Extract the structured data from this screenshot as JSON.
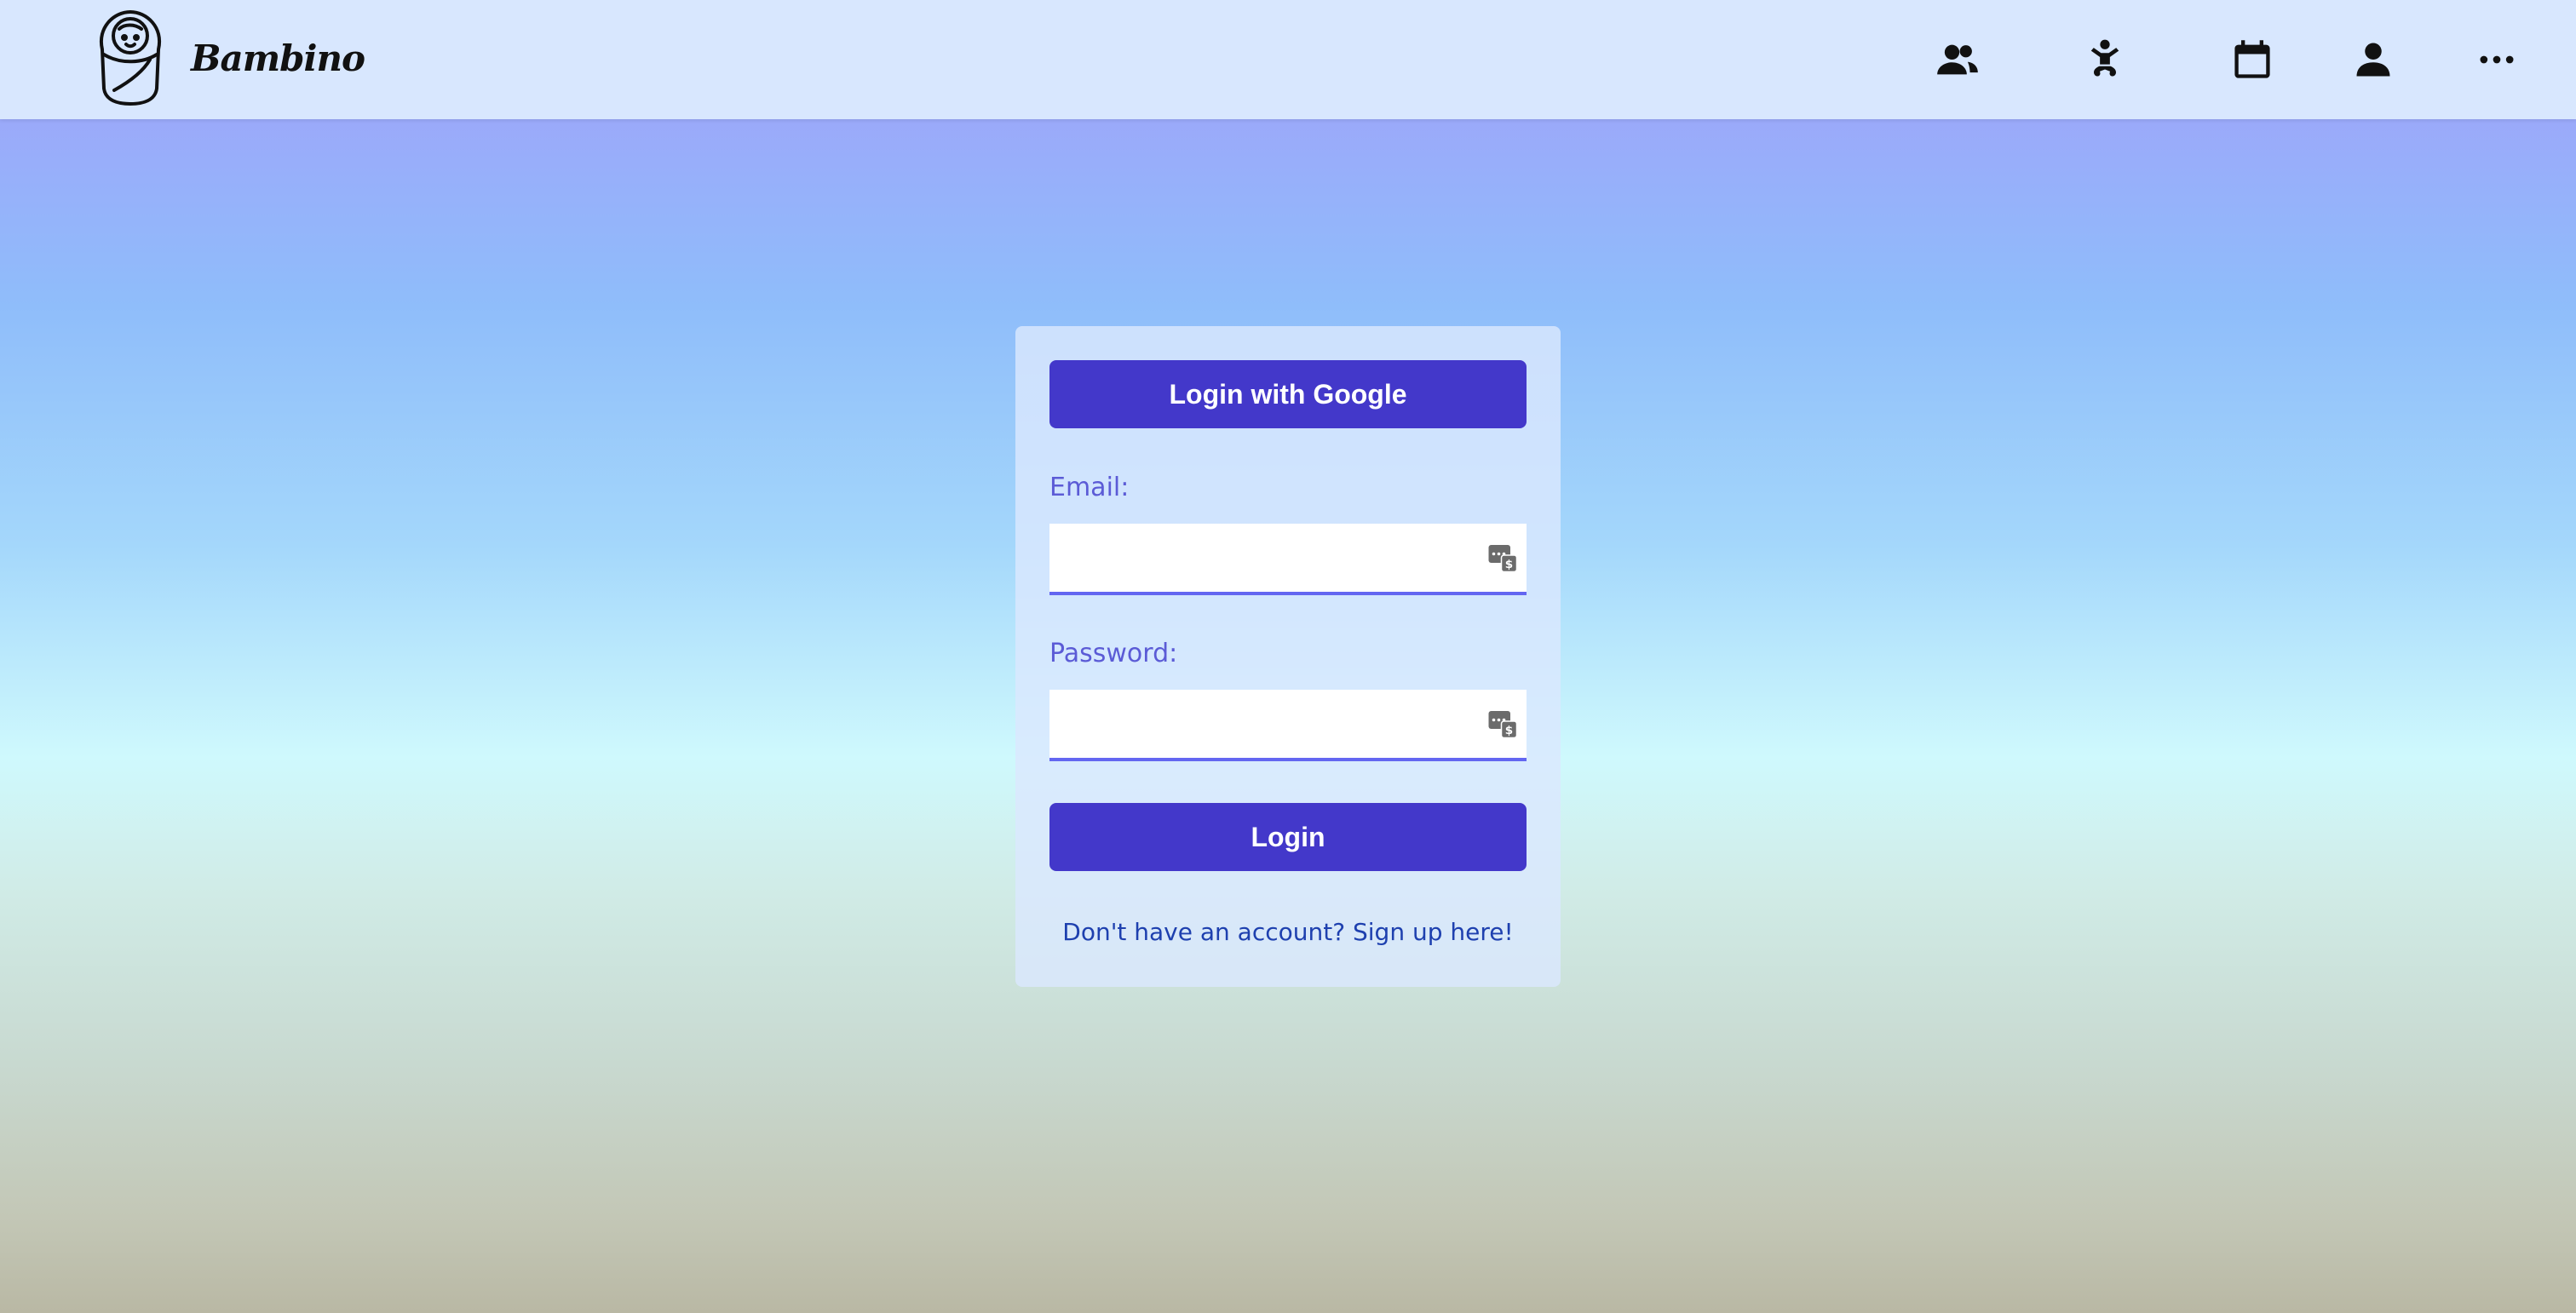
{
  "navbar": {
    "brand_name": "Bambino",
    "icons": {
      "users": "users-icon",
      "baby": "baby-icon",
      "calendar": "calendar-icon",
      "profile": "person-icon",
      "more": "more-horizontal-icon"
    }
  },
  "login": {
    "google_button": "Login with Google",
    "email_label": "Email:",
    "email_value": "",
    "password_label": "Password:",
    "password_value": "",
    "login_button": "Login",
    "signup_text": "Don't have an account? Sign up here!"
  },
  "colors": {
    "navbar_bg": "#d8e7fe",
    "primary": "#4338ca",
    "label": "#5b5bd6",
    "link": "#1e40af",
    "input_underline": "#6366f1"
  }
}
